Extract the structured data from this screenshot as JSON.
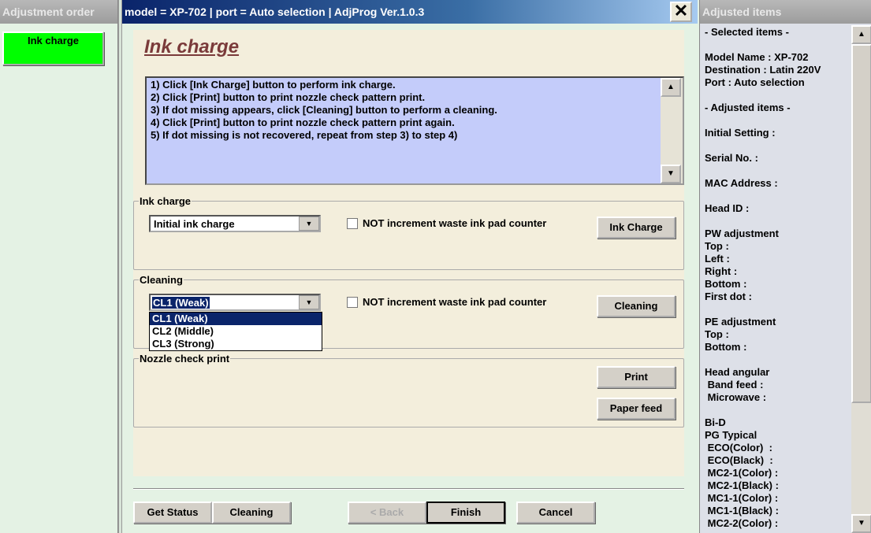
{
  "left": {
    "header": "Adjustment order",
    "items": [
      {
        "label": "Ink charge",
        "color": "#00ff00"
      }
    ]
  },
  "window": {
    "title": "model = XP-702 | port = Auto selection | AdjProg Ver.1.0.3",
    "close": "✕"
  },
  "page": {
    "heading": "Ink charge",
    "instructions": [
      "1) Click [Ink Charge] button to perform ink charge.",
      "2) Click [Print] button to print nozzle check pattern print.",
      "3) If dot missing appears, click [Cleaning] button to perform a cleaning.",
      "4) Click [Print] button to print nozzle check pattern print again.",
      "5) If dot missing is not recovered, repeat from step 3) to step 4)"
    ],
    "ink_charge": {
      "legend": "Ink charge",
      "select": "Initial ink charge",
      "checkbox": "NOT increment waste ink pad counter",
      "checked": false,
      "button": "Ink Charge"
    },
    "cleaning": {
      "legend": "Cleaning",
      "select": "CL1 (Weak)",
      "options": [
        "CL1 (Weak)",
        "CL2 (Middle)",
        "CL3 (Strong)"
      ],
      "checkbox": "NOT increment waste ink pad counter",
      "checked": false,
      "button": "Cleaning"
    },
    "nozzle": {
      "legend": "Nozzle check print",
      "print": "Print",
      "paper_feed": "Paper feed"
    }
  },
  "footer": {
    "get_status": "Get Status",
    "cleaning": "Cleaning",
    "back": "< Back",
    "finish": "Finish",
    "cancel": "Cancel"
  },
  "right": {
    "header": "Adjusted items",
    "lines": [
      "- Selected items -",
      "",
      "Model Name : XP-702",
      "Destination : Latin 220V",
      "Port : Auto selection",
      "",
      "- Adjusted items -",
      "",
      "Initial Setting :",
      "",
      "Serial No. :",
      "",
      "MAC Address :",
      "",
      "Head ID :",
      "",
      "PW adjustment",
      "Top :",
      "Left :",
      "Right :",
      "Bottom :",
      "First dot :",
      "",
      "PE adjustment",
      "Top :",
      "Bottom :",
      "",
      "Head angular",
      " Band feed :",
      " Microwave :",
      "",
      "Bi-D",
      "PG Typical",
      " ECO(Color)  :",
      " ECO(Black)  :",
      " MC2-1(Color) :",
      " MC2-1(Black) :",
      " MC1-1(Color) :",
      " MC1-1(Black) :",
      " MC2-2(Color) :"
    ]
  }
}
